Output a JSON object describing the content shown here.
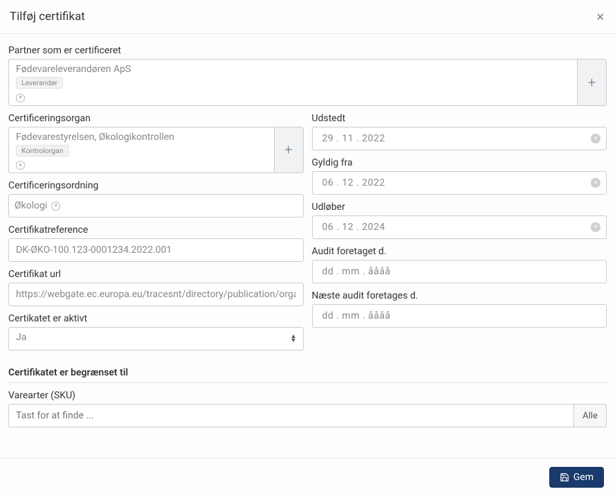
{
  "modal": {
    "title": "Tilføj certifikat",
    "close_glyph": "×"
  },
  "partner": {
    "label": "Partner som er certificeret",
    "name": "Fødevareleverandøren ApS",
    "role_tag": "Leverandør",
    "remove_glyph": "×",
    "add_glyph": "+"
  },
  "cert_body": {
    "label": "Certificeringsorgan",
    "name": "Fødevarestyrelsen, Økologikontrollen",
    "role_tag": "Kontrolorgan",
    "remove_glyph": "×",
    "add_glyph": "+"
  },
  "scheme": {
    "label": "Certificeringsordning",
    "value": "Økologi",
    "remove_glyph": "×"
  },
  "cert_ref": {
    "label": "Certifikatreference",
    "value": "DK-ØKO-100.123-0001234.2022.001"
  },
  "cert_url": {
    "label": "Certifikat url",
    "value": "https://webgate.ec.europa.eu/tracesnt/directory/publication/organi"
  },
  "active": {
    "label": "Certikatet er aktivt",
    "value": "Ja"
  },
  "dates": {
    "issued": {
      "label": "Udstedt",
      "value": "29 . 11 . 2022"
    },
    "valid_from": {
      "label": "Gyldig fra",
      "value": "06 . 12 . 2022"
    },
    "expires": {
      "label": "Udløber",
      "value": "06 . 12 . 2024"
    },
    "audit_done": {
      "label": "Audit foretaget d.",
      "placeholder": "dd . mm . åååå"
    },
    "audit_next": {
      "label": "Næste audit foretages d.",
      "placeholder": "dd . mm . åååå"
    },
    "clear_glyph": "×"
  },
  "limits": {
    "header": "Certifikatet er begrænset til",
    "sku_label": "Varearter (SKU)",
    "sku_placeholder": "Tast for at finde ...",
    "all_button": "Alle"
  },
  "footer": {
    "save_label": "Gem"
  }
}
